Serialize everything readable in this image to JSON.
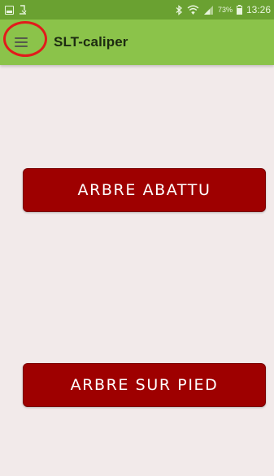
{
  "status_bar": {
    "battery_percent": "73%",
    "time": "13:26",
    "icons": [
      "gallery-icon",
      "download-icon",
      "bluetooth-icon",
      "wifi-icon",
      "signal-icon",
      "battery-icon"
    ]
  },
  "app_bar": {
    "title": "SLT-caliper",
    "menu_icon": "hamburger-menu-icon",
    "color": "#8bc34a",
    "status_bar_color": "#6aa131"
  },
  "annotation": {
    "highlight_color": "#e21b1b",
    "highlighted_element": "hamburger-menu-icon"
  },
  "main": {
    "button_color": "#9e0000",
    "background_color": "#f2eaea",
    "buttons": [
      {
        "label": "ARBRE ABATTU"
      },
      {
        "label": "ARBRE SUR PIED"
      }
    ]
  }
}
